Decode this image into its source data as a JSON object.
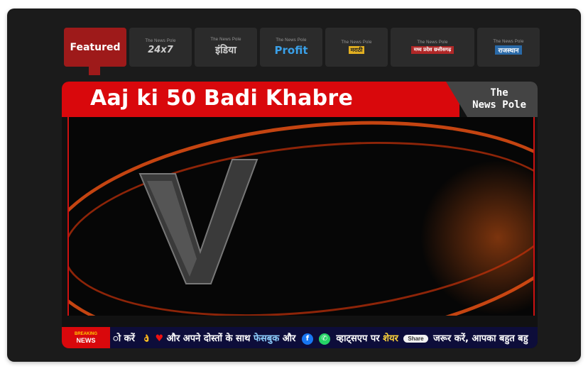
{
  "tabs": [
    {
      "label": "Featured",
      "active": true
    },
    {
      "brand": "The News Pole",
      "sub": "24x7"
    },
    {
      "brand": "The News Pole",
      "sub": "इंडिया"
    },
    {
      "brand": "The News Pole",
      "sub": "Profit"
    },
    {
      "brand": "The News Pole",
      "sub": "मराठी"
    },
    {
      "brand": "The News Pole",
      "sub": "मध्य प्रदेश छत्तीसगढ़"
    },
    {
      "brand": "The News Pole",
      "sub": "राजस्थान"
    }
  ],
  "video": {
    "headline": "Aaj ki 50 Badi Khabre",
    "logo_line1": "The",
    "logo_line2": "News Pole",
    "ticker": {
      "badge_top": "BREAKING",
      "badge_bottom": "NEWS",
      "text_1": "ो करें",
      "text_2": "और अपने दोस्तों के साथ",
      "text_3": "फेसबुक",
      "text_4": "और",
      "text_5": "व्हाट्सएप पर",
      "text_6": "शेयर",
      "share_label": "Share",
      "text_7": "जरूर करें, आपका बहुत बहु"
    }
  },
  "colors": {
    "accent": "#d9080c",
    "tab_active": "#9e1a1a",
    "frame": "#1b1b1b"
  }
}
